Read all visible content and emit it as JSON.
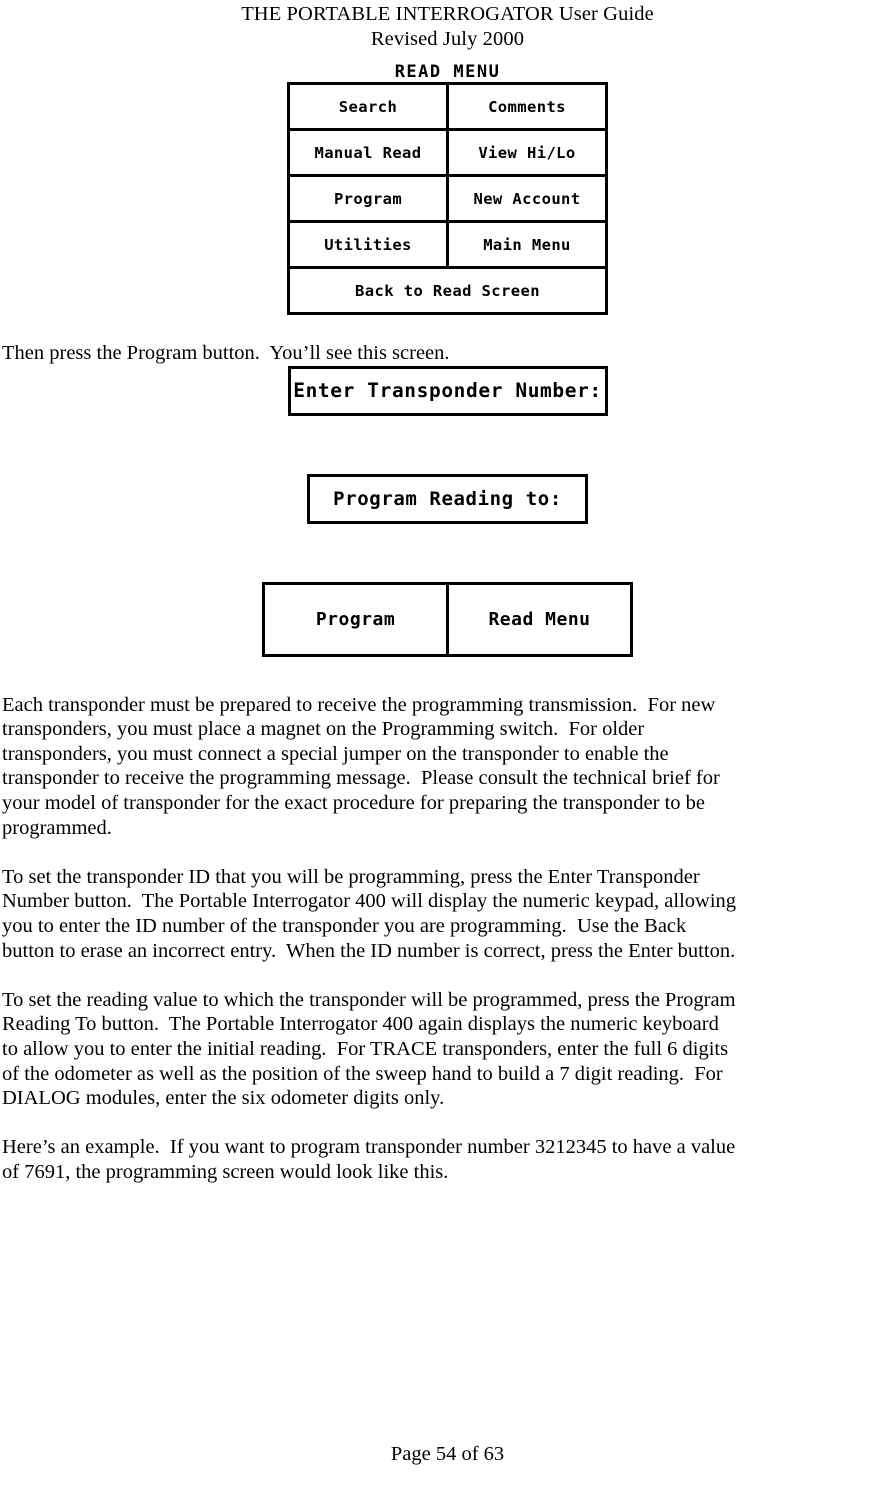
{
  "document": {
    "header_title": "THE PORTABLE INTERROGATOR User Guide",
    "header_subtitle": "Revised July 2000",
    "footer": "Page 54 of 63"
  },
  "read_menu_screen": {
    "title": "READ MENU",
    "rows": [
      {
        "left": "Search",
        "right": "Comments"
      },
      {
        "left": "Manual Read",
        "right": "View Hi/Lo"
      },
      {
        "left": "Program",
        "right": "New Account"
      },
      {
        "left": "Utilities",
        "right": "Main Menu"
      }
    ],
    "full_width_button": "Back to Read Screen"
  },
  "instruction_after_menu": "Then press the Program button.  You’ll see this screen.",
  "program_screen": {
    "enter_transponder_label": "Enter Transponder Number:",
    "program_reading_label": "Program Reading to:",
    "buttons": {
      "program": "Program",
      "read_menu": "Read Menu"
    }
  },
  "paragraphs": [
    "Each transponder must be prepared to receive the programming transmission.  For new\ntransponders, you must place a magnet on the Programming switch.  For older\ntransponders, you must connect a special jumper on the transponder to enable the\ntransponder to receive the programming message.  Please consult the technical brief for\nyour model of transponder for the exact procedure for preparing the transponder to be\nprogrammed.",
    "To set the transponder ID that you will be programming, press the Enter Transponder\nNumber button.  The Portable Interrogator 400 will display the numeric keypad, allowing\nyou to enter the ID number of the transponder you are programming.  Use the Back\nbutton to erase an incorrect entry.  When the ID number is correct, press the Enter button.",
    "To set the reading value to which the transponder will be programmed, press the Program\nReading To button.  The Portable Interrogator 400 again displays the numeric keyboard\nto allow you to enter the initial reading.  For TRACE transponders, enter the full 6 digits\nof the odometer as well as the position of the sweep hand to build a 7 digit reading.  For\nDIALOG modules, enter the six odometer digits only.",
    "Here’s an example.  If you want to program transponder number 3212345 to have a value\nof 7691, the programming screen would look like this."
  ],
  "colors": {
    "page_background": "#ffffff",
    "text": "#000000",
    "lcd_border": "#000000",
    "lcd_background": "#ffffff"
  }
}
